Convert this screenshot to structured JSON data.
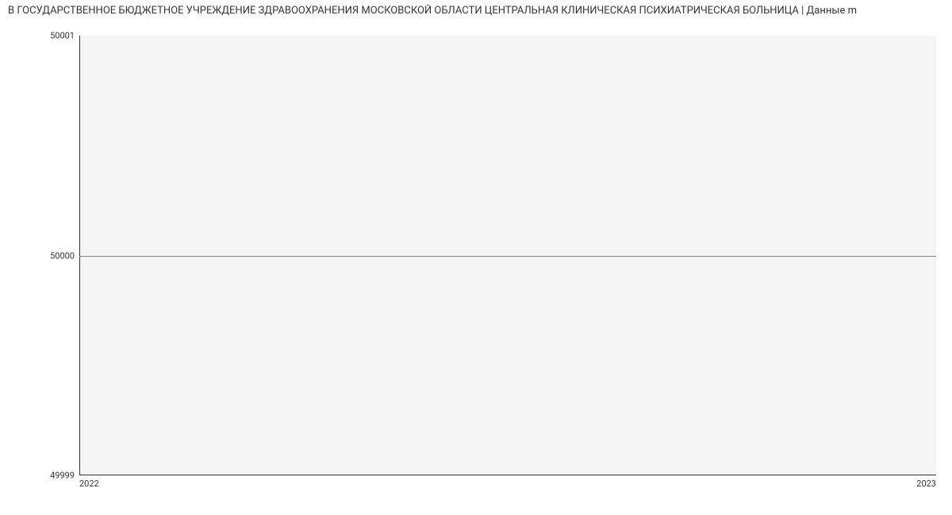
{
  "chart_data": {
    "type": "line",
    "title": "В ГОСУДАРСТВЕННОЕ БЮДЖЕТНОЕ УЧРЕЖДЕНИЕ ЗДРАВООХРАНЕНИЯ МОСКОВСКОЙ ОБЛАСТИ ЦЕНТРАЛЬНАЯ КЛИНИЧЕСКАЯ ПСИХИАТРИЧЕСКАЯ БОЛЬНИЦА | Данные m",
    "x": [
      "2022",
      "2023"
    ],
    "series": [
      {
        "name": "",
        "values": [
          50000,
          50000
        ]
      }
    ],
    "xlabel": "",
    "ylabel": "",
    "xlim": [
      "2022",
      "2023"
    ],
    "ylim": [
      49999,
      50001
    ],
    "x_ticks": [
      "2022",
      "2023"
    ],
    "y_ticks": [
      49999,
      50000,
      50001
    ],
    "line_color": "#4a86e8"
  }
}
